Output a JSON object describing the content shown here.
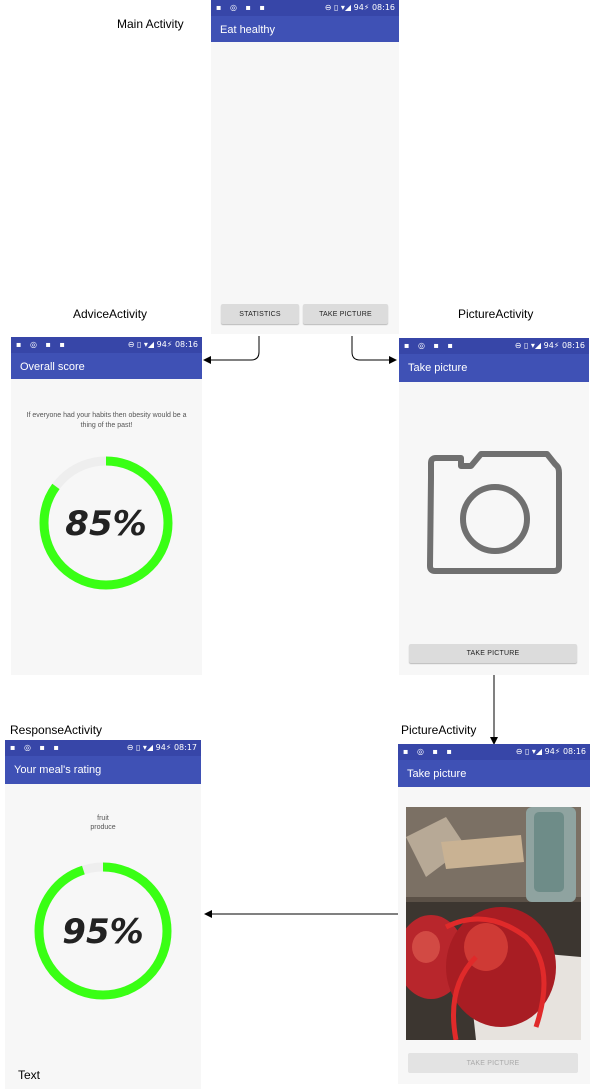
{
  "labels": {
    "main_activity": "Main Activity",
    "advice_activity": "AdviceActivity",
    "picture_activity": "PictureActivity",
    "picture_activity_2": "PictureActivity",
    "response_activity": "ResponseActivity",
    "text_note": "Text"
  },
  "status_bar": {
    "left_icons": "▪ ◎ ▪ ▪",
    "right_main": "⊖ ▯ ▾◢ 94⚡ 08:16",
    "right_response": "⊖ ▯ ▾◢ 94⚡ 08:17"
  },
  "main_screen": {
    "title": "Eat healthy",
    "statistics_button": "STATISTICS",
    "take_picture_button": "TAKE PICTURE"
  },
  "advice_screen": {
    "title": "Overall score",
    "message": "If everyone had your habits then obesity would be a thing of the past!",
    "score": "85%",
    "score_value": 85
  },
  "picture_screen": {
    "title": "Take picture",
    "take_picture_button": "TAKE PICTURE"
  },
  "picture_result_screen": {
    "title": "Take picture",
    "take_picture_button": "TAKE PICTURE"
  },
  "response_screen": {
    "title": "Your meal's rating",
    "tag_1": "fruit",
    "tag_2": "produce",
    "score": "95%",
    "score_value": 95
  },
  "colors": {
    "status_bar": "#3746a8",
    "app_bar": "#3f51b5",
    "ring_green": "#39ff14",
    "ring_track": "#eeeeee"
  }
}
